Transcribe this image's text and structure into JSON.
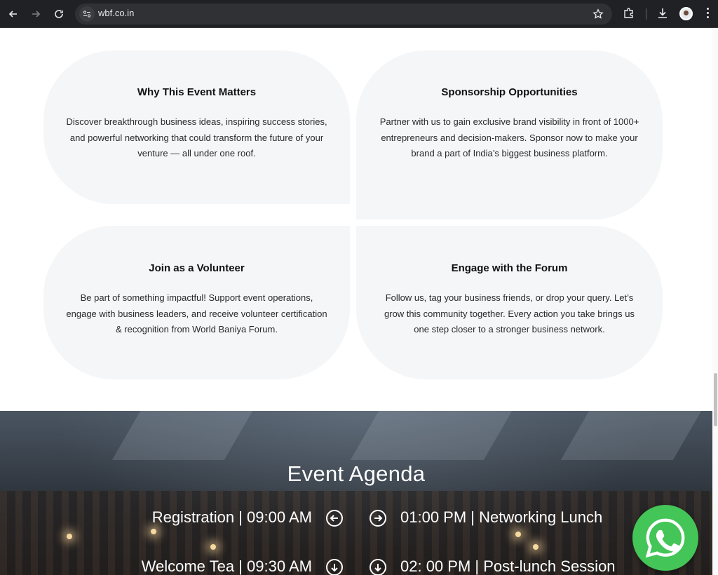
{
  "browser": {
    "url": "wbf.co.in"
  },
  "cards": [
    {
      "title": "Why This Event Matters",
      "body": "Discover breakthrough business ideas, inspiring success stories, and powerful networking that could transform the future of your venture — all under one roof."
    },
    {
      "title": "Sponsorship Opportunities",
      "body": "Partner with us to gain exclusive brand visibility in front of 1000+ entrepreneurs and decision-makers. Sponsor now to make your brand a part of India’s biggest business platform."
    },
    {
      "title": "Join as a Volunteer",
      "body": "Be part of something impactful! Support event operations, engage with business leaders, and receive volunteer certification & recognition from World Baniya Forum."
    },
    {
      "title": "Engage with the Forum",
      "body": "Follow us, tag your business friends, or drop your query. Let’s grow this community together. Every action you take brings us one step closer to a stronger business network."
    }
  ],
  "agenda": {
    "title": "Event Agenda",
    "items": [
      {
        "left": "Registration | 09:00 AM",
        "right": "01:00 PM | Networking Lunch"
      },
      {
        "left": "Welcome Tea | 09:30 AM",
        "right": "02: 00 PM | Post-lunch Session"
      }
    ]
  },
  "colors": {
    "card_bg": "#f5f6f8",
    "whatsapp_green": "#44c557",
    "chrome_bg": "#202124"
  }
}
